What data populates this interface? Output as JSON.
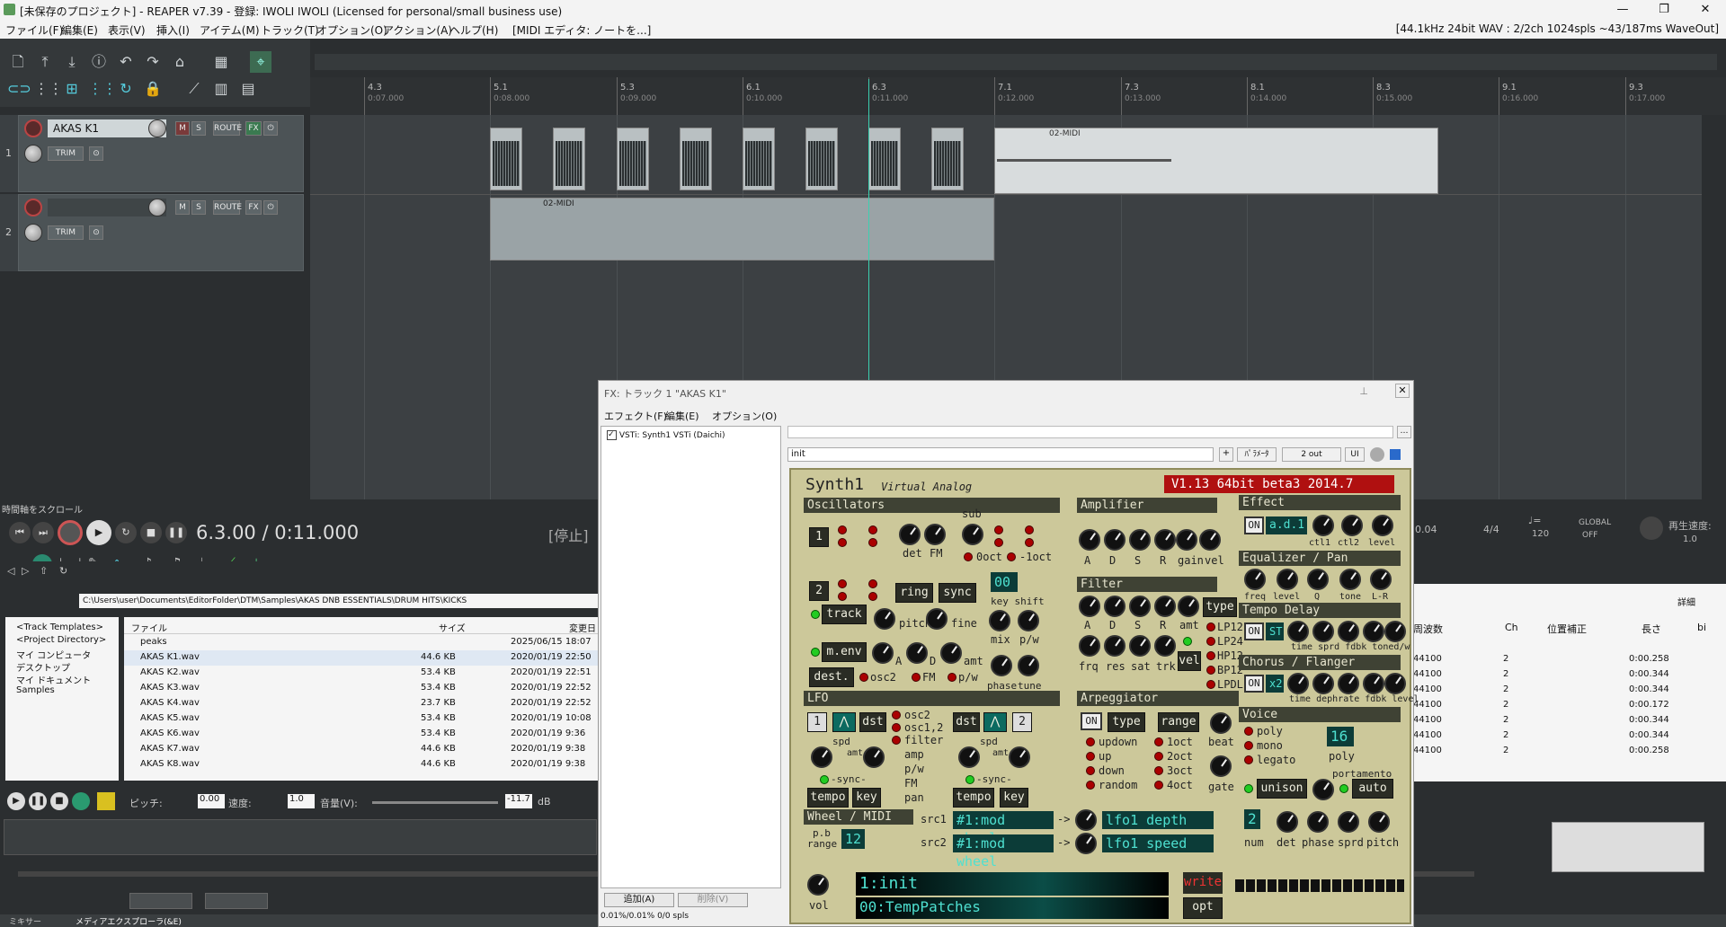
{
  "window": {
    "title": "[未保存のプロジェクト] - REAPER v7.39 - 登録: IWOLI IWOLI (Licensed for personal/small business use)",
    "status": "[44.1kHz 24bit WAV : 2/2ch 1024spls ~43/187ms WaveOut]"
  },
  "menu": [
    "ファイル(F)",
    "編集(E)",
    "表示(V)",
    "挿入(I)",
    "アイテム(M)",
    "トラック(T)",
    "オプション(O)",
    "アクション(A)",
    "ヘルプ(H)",
    "[MIDI エディタ: ノートを...]"
  ],
  "ruler": [
    {
      "m": "4.3",
      "s": "0:07.000"
    },
    {
      "m": "5.1",
      "s": "0:08.000"
    },
    {
      "m": "5.3",
      "s": "0:09.000"
    },
    {
      "m": "6.1",
      "s": "0:10.000"
    },
    {
      "m": "6.3",
      "s": "0:11.000"
    },
    {
      "m": "7.1",
      "s": "0:12.000"
    },
    {
      "m": "7.3",
      "s": "0:13.000"
    },
    {
      "m": "8.1",
      "s": "0:14.000"
    },
    {
      "m": "8.3",
      "s": "0:15.000"
    },
    {
      "m": "9.1",
      "s": "0:16.000"
    },
    {
      "m": "9.3",
      "s": "0:17.000"
    }
  ],
  "tracks": [
    {
      "num": "1",
      "name": "AKAS K1",
      "route": "ROUTE",
      "fx": "FX",
      "trim": "TRIM",
      "m": "M",
      "s": "S"
    },
    {
      "num": "2",
      "name": "",
      "route": "ROUTE",
      "fx": "FX",
      "trim": "TRIM",
      "m": "M",
      "s": "S"
    }
  ],
  "items": {
    "midi1": "02-MIDI",
    "midi2": "02-MIDI"
  },
  "transport": {
    "scroll_label": "時間軸をスクロール",
    "position": "6.3.00 / 0:11.000",
    "state": "[停止]"
  },
  "transport_right": {
    "time": "0.04",
    "meter": "4/4",
    "bpm_label": "♩=",
    "bpm": "120",
    "global": "GLOBAL",
    "global_state": "OFF",
    "rate_label": "再生速度:",
    "rate": "1.0"
  },
  "explorer": {
    "path": "C:\\Users\\user\\Documents\\EditorFolder\\DTM\\Samples\\AKAS DNB ESSENTIALS\\DRUM HITS\\KICKS",
    "tree": [
      "<Track Templates>",
      "<Project Directory>",
      "マイ コンピュータ",
      "デスクトップ",
      "マイ ドキュメント",
      "Samples"
    ],
    "columns": {
      "file": "ファイル",
      "size": "サイズ",
      "date": "変更日"
    },
    "files": [
      {
        "name": "peaks",
        "size": "",
        "date": "2025/06/15 18:07"
      },
      {
        "name": "AKAS K1.wav",
        "size": "44.6 KB",
        "date": "2020/01/19 22:50"
      },
      {
        "name": "AKAS K2.wav",
        "size": "53.4 KB",
        "date": "2020/01/19 22:51"
      },
      {
        "name": "AKAS K3.wav",
        "size": "53.4 KB",
        "date": "2020/01/19 22:52"
      },
      {
        "name": "AKAS K4.wav",
        "size": "23.7 KB",
        "date": "2020/01/19 22:52"
      },
      {
        "name": "AKAS K5.wav",
        "size": "53.4 KB",
        "date": "2020/01/19 10:08"
      },
      {
        "name": "AKAS K6.wav",
        "size": "53.4 KB",
        "date": "2020/01/19 9:36"
      },
      {
        "name": "AKAS K7.wav",
        "size": "44.6 KB",
        "date": "2020/01/19 9:38"
      },
      {
        "name": "AKAS K8.wav",
        "size": "44.6 KB",
        "date": "2020/01/19 9:38"
      }
    ],
    "pitch_label": "ピッチ:",
    "pitch": "0.00",
    "speed_label": "速度:",
    "speed": "1.0",
    "volume_label": "音量(V):",
    "volume": "-11.7",
    "db": "dB",
    "tab_mixer": "ミキサー",
    "tab_explorer": "メディアエクスプローラ(&E)"
  },
  "explorer_right": {
    "columns": [
      "周波数",
      "Ch",
      "位置補正",
      "長さ",
      "bi"
    ],
    "detail": "詳細",
    "rows": [
      {
        "freq": "44100",
        "ch": "2",
        "len": "0:00.258"
      },
      {
        "freq": "44100",
        "ch": "2",
        "len": "0:00.344"
      },
      {
        "freq": "44100",
        "ch": "2",
        "len": "0:00.344"
      },
      {
        "freq": "44100",
        "ch": "2",
        "len": "0:00.172"
      },
      {
        "freq": "44100",
        "ch": "2",
        "len": "0:00.344"
      },
      {
        "freq": "44100",
        "ch": "2",
        "len": "0:00.344"
      },
      {
        "freq": "44100",
        "ch": "2",
        "len": "0:00.258"
      }
    ]
  },
  "fx": {
    "title": "FX: トラック 1 \"AKAS K1\"",
    "menu": [
      "エフェクト(F)",
      "編集(E)",
      "オプション(O)"
    ],
    "plugin": "VSTi: Synth1 VSTi (Daichi)",
    "preset": "init",
    "plus": "+",
    "param": "ﾊﾟﾗﾒｰﾀ",
    "out": "2 out",
    "ui": "UI",
    "add": "追加(A)",
    "remove": "削除(V)",
    "cpu": "0.01%/0.01% 0/0 spls"
  },
  "synth": {
    "name": "Synth1",
    "sub": "Virtual Analog",
    "version": "V1.13 64bit beta3 2014.7",
    "oscillators": "Oscillators",
    "amplifier": "Amplifier",
    "effect": "Effect",
    "filter": "Filter",
    "eq": "Equalizer / Pan",
    "tempo_delay": "Tempo Delay",
    "chorus": "Chorus / Flanger",
    "lfo": "LFO",
    "arp": "Arpeggiator",
    "voice": "Voice",
    "wheel": "Wheel / MIDI",
    "osc1": "1",
    "osc2": "2",
    "det": "det",
    "fm": "FM",
    "sub_label": "sub",
    "oct0": "0oct",
    "oct_minus1": "-1oct",
    "ring": "ring",
    "sync": "sync",
    "track": "track",
    "pitch": "pitch",
    "fine": "fine",
    "key_shift": "key shift",
    "shift_val": "00",
    "mix": "mix",
    "pw": "p/w",
    "menv": "m.env",
    "dest": "dest.",
    "osc2_dest": "osc2",
    "fm_dest": "FM",
    "pw_dest": "p/w",
    "phase": "phase",
    "tune": "tune",
    "a": "A",
    "d": "D",
    "s": "S",
    "r": "R",
    "gain": "gain",
    "vel": "vel",
    "amt": "amt",
    "frq": "frq",
    "res": "res",
    "sat": "sat",
    "trk": "trk",
    "type": "type",
    "filter_types": [
      "LP12",
      "LP24",
      "HP12",
      "BP12",
      "LPDL"
    ],
    "on": "ON",
    "adl": "a.d.1",
    "ctl1": "ctl1",
    "ctl2": "ctl2",
    "level": "level",
    "freq": "freq",
    "q": "Q",
    "tone": "tone",
    "lr": "L-R",
    "st": "ST",
    "delay_labels": "time sprd fdbk toned/w",
    "x2": "x2",
    "chorus_labels": "time dephrate fdbk level",
    "lfo1": "1",
    "lfo2": "2",
    "dst": "dst",
    "spd": "spd",
    "lfo_dest": [
      "osc2",
      "osc1,2",
      "filter",
      "amp",
      "p/w",
      "FM",
      "pan"
    ],
    "sync_label": "-sync-",
    "tempo": "tempo",
    "key": "key",
    "arp_on": "ON",
    "arp_type": "type",
    "range": "range",
    "beat": "beat",
    "gate": "gate",
    "arp_modes": [
      "updown",
      "up",
      "down",
      "random"
    ],
    "arp_ranges": [
      "1oct",
      "2oct",
      "3oct",
      "4oct"
    ],
    "voice_modes": [
      "poly",
      "mono",
      "legato"
    ],
    "poly_num": "16",
    "poly_label": "poly",
    "portamento": "portamento",
    "auto": "auto",
    "unison": "unison",
    "num_val": "2",
    "num": "num",
    "phase2": "phase",
    "sprd": "sprd",
    "pitch2": "pitch",
    "pb": "p.b",
    "pb_range": "range",
    "pb_val": "12",
    "src1": "src1",
    "src2": "src2",
    "src1_val": "#1:mod wheel",
    "src2_val": "#1:mod wheel",
    "arrow": "->",
    "dest1": "lfo1 depth",
    "dest2": "lfo1 speed",
    "vol": "vol",
    "patch": "1:init",
    "bank": "00:TempPatches",
    "write": "write",
    "opt": "opt"
  }
}
